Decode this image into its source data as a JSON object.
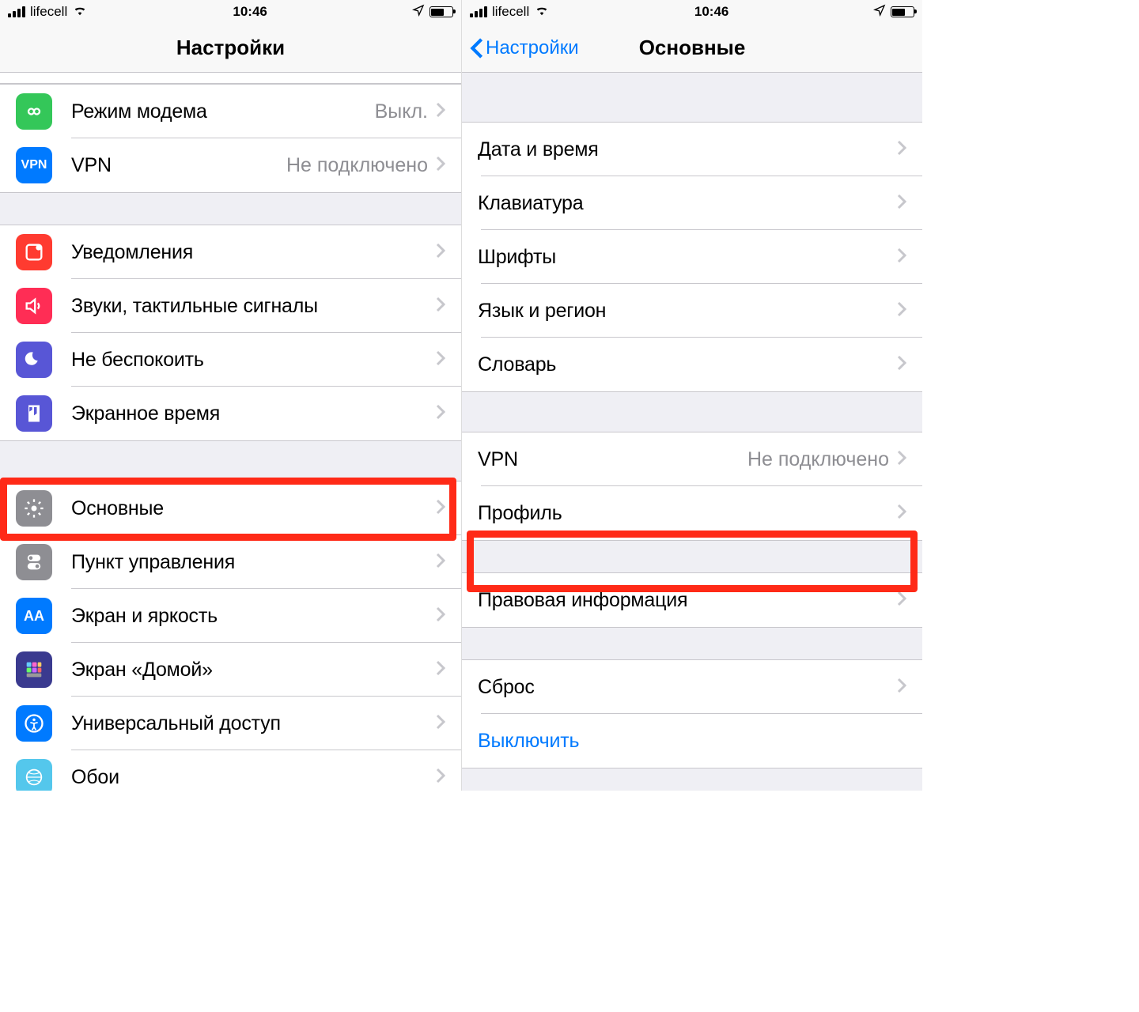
{
  "status": {
    "carrier": "lifecell",
    "time": "10:46"
  },
  "left": {
    "title": "Настройки",
    "rows": {
      "hotspot": {
        "label": "Режим модема",
        "value": "Выкл."
      },
      "vpn": {
        "label": "VPN",
        "value": "Не подключено"
      },
      "notifications": {
        "label": "Уведомления"
      },
      "sounds": {
        "label": "Звуки, тактильные сигналы"
      },
      "dnd": {
        "label": "Не беспокоить"
      },
      "screentime": {
        "label": "Экранное время"
      },
      "general": {
        "label": "Основные"
      },
      "control": {
        "label": "Пункт управления"
      },
      "display": {
        "label": "Экран и яркость"
      },
      "home": {
        "label": "Экран «Домой»"
      },
      "accessibility": {
        "label": "Универсальный доступ"
      },
      "wallpaper": {
        "label": "Обои"
      }
    }
  },
  "right": {
    "back": "Настройки",
    "title": "Основные",
    "rows": {
      "datetime": {
        "label": "Дата и время"
      },
      "keyboard": {
        "label": "Клавиатура"
      },
      "fonts": {
        "label": "Шрифты"
      },
      "lang": {
        "label": "Язык и регион"
      },
      "dict": {
        "label": "Словарь"
      },
      "vpn": {
        "label": "VPN",
        "value": "Не подключено"
      },
      "profile": {
        "label": "Профиль"
      },
      "legal": {
        "label": "Правовая информация"
      },
      "reset": {
        "label": "Сброс"
      },
      "shutdown": {
        "label": "Выключить"
      }
    }
  }
}
